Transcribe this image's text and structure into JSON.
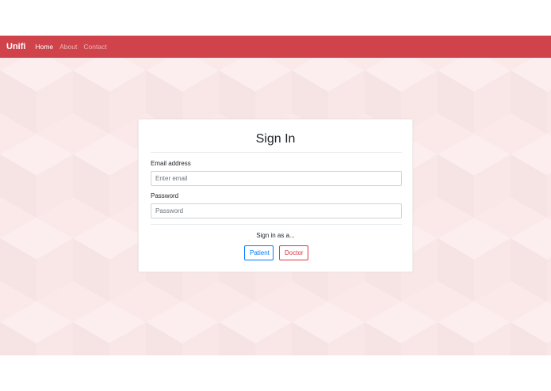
{
  "navbar": {
    "brand": "Unifi",
    "links": [
      {
        "label": "Home",
        "active": true
      },
      {
        "label": "About",
        "active": false
      },
      {
        "label": "Contact",
        "active": false
      }
    ],
    "color": "#d1434b"
  },
  "background": {
    "color": "#fbe9e9",
    "pattern": "isometric-cubes"
  },
  "signin": {
    "title": "Sign In",
    "email_label": "Email address",
    "email_placeholder": "Enter email",
    "email_value": "",
    "password_label": "Password",
    "password_placeholder": "Password",
    "password_value": "",
    "role_prompt": "Sign in as a...",
    "patient_label": "Patient",
    "doctor_label": "Doctor",
    "patient_color": "#007bff",
    "doctor_color": "#dc3545"
  }
}
